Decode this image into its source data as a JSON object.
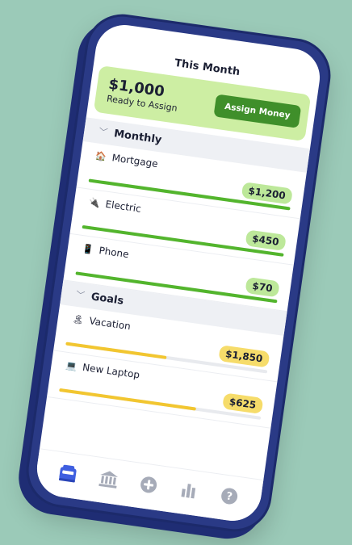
{
  "header": {
    "title": "This Month"
  },
  "assign": {
    "amount": "$1,000",
    "label": "Ready to Assign",
    "button": "Assign Money"
  },
  "sections": [
    {
      "title": "Monthly",
      "color": "#53b52d",
      "items": [
        {
          "name": "Mortgage",
          "icon": "house-icon",
          "amount": "$1,200",
          "progress": 1.0
        },
        {
          "name": "Electric",
          "icon": "plug-icon",
          "amount": "$450",
          "progress": 1.0
        },
        {
          "name": "Phone",
          "icon": "phone-icon",
          "amount": "$70",
          "progress": 1.0
        }
      ]
    },
    {
      "title": "Goals",
      "color": "#f2c630",
      "items": [
        {
          "name": "Vacation",
          "icon": "beach-icon",
          "amount": "$1,850",
          "progress": 0.5
        },
        {
          "name": "New Laptop",
          "icon": "laptop-icon",
          "amount": "$625",
          "progress": 0.68
        }
      ]
    }
  ],
  "tabs": [
    {
      "icon": "budget-icon",
      "active": true
    },
    {
      "icon": "bank-icon",
      "active": false
    },
    {
      "icon": "add-icon",
      "active": false
    },
    {
      "icon": "reports-icon",
      "active": false
    },
    {
      "icon": "help-icon",
      "active": false
    }
  ],
  "colors": {
    "accent": "#3f8f2a",
    "active_tab": "#3f5fe0",
    "inactive_tab": "#a6abb8"
  }
}
